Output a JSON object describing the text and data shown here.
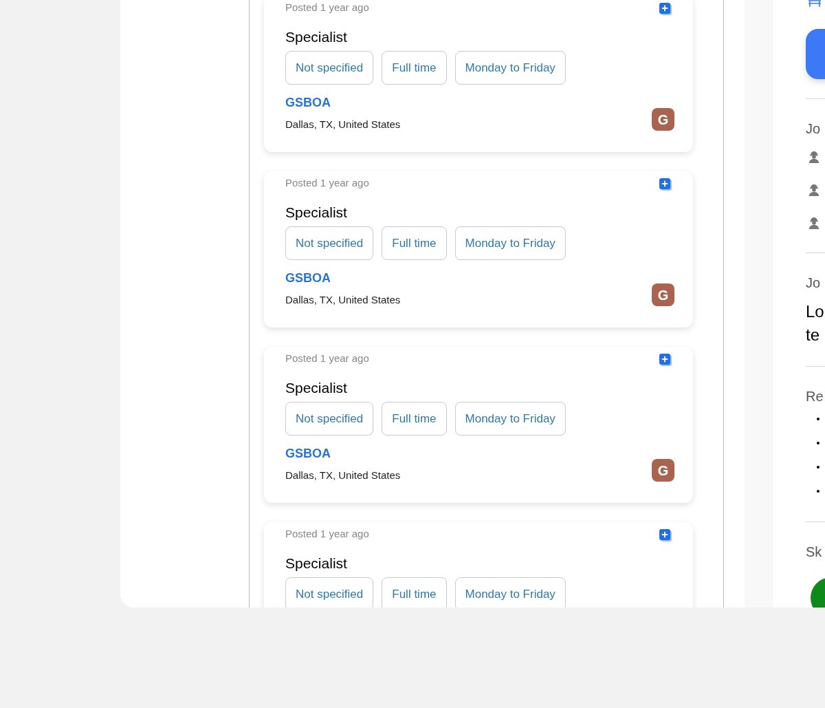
{
  "job_cards": [
    {
      "posted": "Posted 1 year ago",
      "title": "Specialist",
      "tags": [
        "Not specified",
        "Full time",
        "Monday to Friday"
      ],
      "company": "GSBOA",
      "location": "Dallas, TX, United States",
      "avatar_letter": "G"
    },
    {
      "posted": "Posted 1 year ago",
      "title": "Specialist",
      "tags": [
        "Not specified",
        "Full time",
        "Monday to Friday"
      ],
      "company": "GSBOA",
      "location": "Dallas, TX, United States",
      "avatar_letter": "G"
    },
    {
      "posted": "Posted 1 year ago",
      "title": "Specialist",
      "tags": [
        "Not specified",
        "Full time",
        "Monday to Friday"
      ],
      "company": "GSBOA",
      "location": "Dallas, TX, United States",
      "avatar_letter": "G"
    },
    {
      "posted": "Posted 1 year ago",
      "title": "Specialist",
      "tags": [
        "Not specified",
        "Full time",
        "Monday to Friday"
      ]
    }
  ],
  "detail_panel": {
    "job_type_heading": "Jo",
    "description_heading": "Jo",
    "description_lines": [
      "Lo",
      "te"
    ],
    "requirements_heading": "Re",
    "skills_heading": "Sk"
  }
}
